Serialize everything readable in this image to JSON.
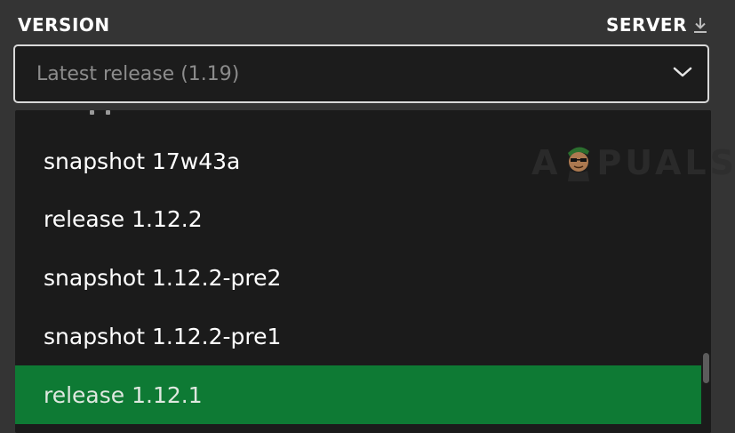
{
  "header": {
    "version_label": "VERSION",
    "server_label": "SERVER",
    "server_icon": "download-icon"
  },
  "select": {
    "value": "Latest release (1.19)",
    "chevron_icon": "chevron-down-icon"
  },
  "dropdown": {
    "options": [
      "snapshot 17w43a",
      "release 1.12.2",
      "snapshot 1.12.2-pre2",
      "snapshot 1.12.2-pre1",
      "release 1.12.1"
    ],
    "selected_index": 4,
    "selected_color": "#0e7a34",
    "scroll_position": 0.82
  },
  "watermark": {
    "text_left": "A",
    "text_right": "PUALS"
  },
  "colors": {
    "background": "#343434",
    "dropdown_bg": "#1b1b1b",
    "accent_green": "#0e7a34"
  }
}
